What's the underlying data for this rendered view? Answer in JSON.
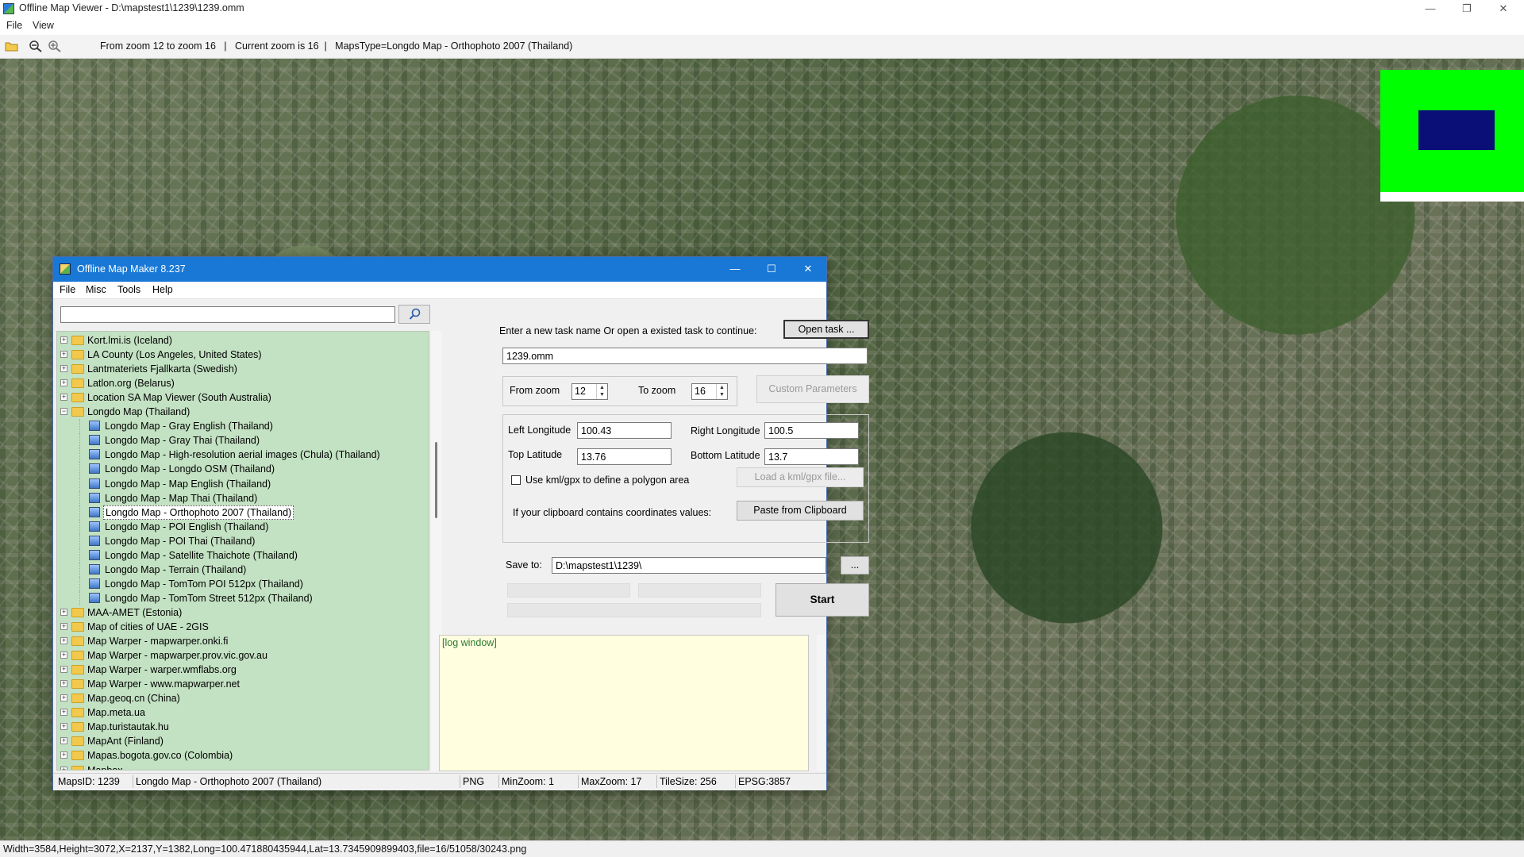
{
  "viewer": {
    "title": "Offline Map Viewer - D:\\mapstest1\\1239\\1239.omm",
    "menu": [
      "File",
      "View"
    ],
    "toolbar_info": "From zoom 12 to zoom 16   |   Current zoom is 16  |   MapsType=Longdo Map - Orthophoto 2007 (Thailand)",
    "status": "Width=3584,Height=3072,X=2137,Y=1382,Long=100.471880435944,Lat=13.7345909899403,file=16/51058/30243.png",
    "window_controls": [
      "—",
      "❐",
      "✕"
    ]
  },
  "maker": {
    "title": "Offline Map Maker 8.237",
    "menu": [
      "File",
      "Misc",
      "Tools",
      "Help"
    ],
    "window_controls": [
      "—",
      "☐",
      "✕"
    ],
    "search": {
      "value": ""
    },
    "tree": [
      {
        "label": "Kort.lmi.is (Iceland)",
        "level": 0,
        "type": "folder",
        "expanded": false
      },
      {
        "label": "LA County (Los Angeles, United States)",
        "level": 0,
        "type": "folder",
        "expanded": false
      },
      {
        "label": "Lantmateriets Fjallkarta (Swedish)",
        "level": 0,
        "type": "folder",
        "expanded": false
      },
      {
        "label": "Latlon.org (Belarus)",
        "level": 0,
        "type": "folder",
        "expanded": false
      },
      {
        "label": "Location SA Map Viewer (South Australia)",
        "level": 0,
        "type": "folder",
        "expanded": false
      },
      {
        "label": "Longdo Map (Thailand)",
        "level": 0,
        "type": "folder",
        "expanded": true
      },
      {
        "label": "Longdo Map - Gray English (Thailand)",
        "level": 1,
        "type": "map"
      },
      {
        "label": "Longdo Map - Gray Thai (Thailand)",
        "level": 1,
        "type": "map"
      },
      {
        "label": "Longdo Map - High-resolution aerial images (Chula) (Thailand)",
        "level": 1,
        "type": "map"
      },
      {
        "label": "Longdo Map - Longdo OSM (Thailand)",
        "level": 1,
        "type": "map"
      },
      {
        "label": "Longdo Map - Map English (Thailand)",
        "level": 1,
        "type": "map"
      },
      {
        "label": "Longdo Map - Map Thai (Thailand)",
        "level": 1,
        "type": "map"
      },
      {
        "label": "Longdo Map - Orthophoto 2007 (Thailand)",
        "level": 1,
        "type": "map",
        "selected": true
      },
      {
        "label": "Longdo Map - POI English (Thailand)",
        "level": 1,
        "type": "map"
      },
      {
        "label": "Longdo Map - POI Thai (Thailand)",
        "level": 1,
        "type": "map"
      },
      {
        "label": "Longdo Map - Satellite Thaichote (Thailand)",
        "level": 1,
        "type": "map"
      },
      {
        "label": "Longdo Map - Terrain (Thailand)",
        "level": 1,
        "type": "map"
      },
      {
        "label": "Longdo Map - TomTom POI 512px (Thailand)",
        "level": 1,
        "type": "map"
      },
      {
        "label": "Longdo Map - TomTom Street 512px (Thailand)",
        "level": 1,
        "type": "map"
      },
      {
        "label": "MAA-AMET (Estonia)",
        "level": 0,
        "type": "folder",
        "expanded": false
      },
      {
        "label": "Map of cities of UAE - 2GIS",
        "level": 0,
        "type": "folder",
        "expanded": false
      },
      {
        "label": "Map Warper - mapwarper.onki.fi",
        "level": 0,
        "type": "folder",
        "expanded": false
      },
      {
        "label": "Map Warper - mapwarper.prov.vic.gov.au",
        "level": 0,
        "type": "folder",
        "expanded": false
      },
      {
        "label": "Map Warper - warper.wmflabs.org",
        "level": 0,
        "type": "folder",
        "expanded": false
      },
      {
        "label": "Map Warper - www.mapwarper.net",
        "level": 0,
        "type": "folder",
        "expanded": false
      },
      {
        "label": "Map.geoq.cn (China)",
        "level": 0,
        "type": "folder",
        "expanded": false
      },
      {
        "label": "Map.meta.ua",
        "level": 0,
        "type": "folder",
        "expanded": false
      },
      {
        "label": "Map.turistautak.hu",
        "level": 0,
        "type": "folder",
        "expanded": false
      },
      {
        "label": "MapAnt (Finland)",
        "level": 0,
        "type": "folder",
        "expanded": false
      },
      {
        "label": "Mapas.bogota.gov.co (Colombia)",
        "level": 0,
        "type": "folder",
        "expanded": false
      },
      {
        "label": "Mapbox",
        "level": 0,
        "type": "folder",
        "expanded": false
      }
    ],
    "task_prompt": "Enter a new task name Or open a existed task to continue:",
    "open_task_label": "Open task ...",
    "task_name": "1239.omm",
    "from_zoom_label": "From zoom",
    "from_zoom": "12",
    "to_zoom_label": "To zoom",
    "to_zoom": "16",
    "custom_params_label": "Custom Parameters",
    "left_lon_label": "Left Longitude",
    "left_lon": "100.43",
    "right_lon_label": "Right Longitude",
    "right_lon": "100.5",
    "top_lat_label": "Top Latitude",
    "top_lat": "13.76",
    "bottom_lat_label": "Bottom Latitude",
    "bottom_lat": "13.7",
    "kml_label": "Use kml/gpx to define a polygon area",
    "load_kml_label": "Load a kml/gpx file...",
    "clipboard_label": "If your clipboard contains coordinates values:",
    "paste_label": "Paste from Clipboard",
    "save_to_label": "Save to:",
    "save_to": "D:\\mapstest1\\1239\\",
    "browse_label": "...",
    "start_label": "Start",
    "log_text": "[log window]",
    "status": {
      "maps_id": "MapsID: 1239",
      "maps_name": "Longdo Map - Orthophoto 2007 (Thailand)",
      "format": "PNG",
      "min_zoom": "MinZoom: 1",
      "max_zoom": "MaxZoom: 17",
      "tile_size": "TileSize: 256",
      "epsg": "EPSG:3857"
    }
  },
  "colors": {
    "maker_titlebar": "#1978d6",
    "tree_bg": "#c3e1c3",
    "log_bg": "#ffffe0",
    "overview_bg": "#00ff00",
    "overview_rect": "#0a0f78"
  }
}
